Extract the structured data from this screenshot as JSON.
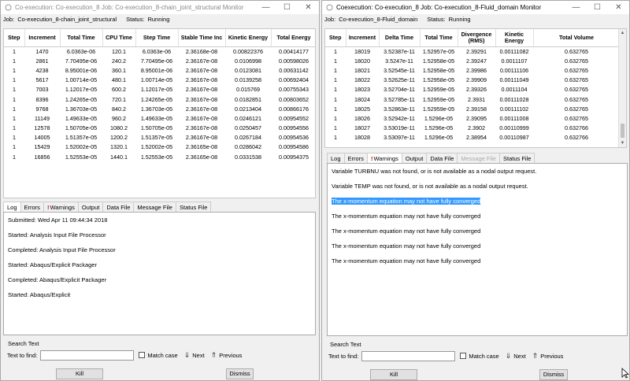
{
  "windows": [
    {
      "title": "Co-execution: Co-execution_8 Job: Co-execution_8-chain_joint_structural Monitor",
      "job_label": "Job:",
      "job": "Co-execution_8-chain_joint_structural",
      "status_label": "Status:",
      "status": "Running",
      "columns": [
        "Step",
        "Increment",
        "Total Time",
        "CPU Time",
        "Step Time",
        "Stable Time Inc",
        "Kinetic Energy",
        "Total Energy"
      ],
      "rows": [
        [
          "1",
          "1470",
          "6.0363e-06",
          "120.1",
          "6.0363e-06",
          "2.36168e-08",
          "0.00822376",
          "0.00414177"
        ],
        [
          "1",
          "2861",
          "7.70495e-06",
          "240.2",
          "7.70495e-06",
          "2.36167e-08",
          "0.0106998",
          "0.00598026"
        ],
        [
          "1",
          "4238",
          "8.95001e-06",
          "360.1",
          "8.95001e-06",
          "2.36167e-08",
          "0.0123081",
          "0.00631142"
        ],
        [
          "1",
          "5617",
          "1.00714e-05",
          "480.1",
          "1.00714e-05",
          "2.36167e-08",
          "0.0139258",
          "0.00692404"
        ],
        [
          "1",
          "7003",
          "1.12017e-05",
          "600.2",
          "1.12017e-05",
          "2.36167e-08",
          "0.015769",
          "0.00755343"
        ],
        [
          "1",
          "8396",
          "1.24265e-05",
          "720.1",
          "1.24265e-05",
          "2.36167e-08",
          "0.0182851",
          "0.00803652"
        ],
        [
          "1",
          "9768",
          "1.36703e-05",
          "840.2",
          "1.36703e-05",
          "2.36167e-08",
          "0.0213404",
          "0.00866176"
        ],
        [
          "1",
          "11149",
          "1.49633e-05",
          "960.2",
          "1.49633e-05",
          "2.36167e-08",
          "0.0246121",
          "0.00954552"
        ],
        [
          "1",
          "12578",
          "1.50705e-05",
          "1080.2",
          "1.50705e-05",
          "2.36167e-08",
          "0.0250457",
          "0.00954556"
        ],
        [
          "1",
          "14005",
          "1.51357e-05",
          "1200.2",
          "1.51357e-05",
          "2.36167e-08",
          "0.0267184",
          "0.00954536"
        ],
        [
          "1",
          "15429",
          "1.52002e-05",
          "1320.1",
          "1.52002e-05",
          "2.36165e-08",
          "0.0286042",
          "0.00954586"
        ],
        [
          "1",
          "16856",
          "1.52553e-05",
          "1440.1",
          "1.52553e-05",
          "2.36165e-08",
          "0.0331538",
          "0.00954375"
        ]
      ],
      "tabs": [
        {
          "label": "Log",
          "active": true,
          "warn": false,
          "disabled": false
        },
        {
          "label": "Errors",
          "active": false,
          "warn": false,
          "disabled": false
        },
        {
          "label": "Warnings",
          "active": false,
          "warn": true,
          "disabled": false
        },
        {
          "label": "Output",
          "active": false,
          "warn": false,
          "disabled": false
        },
        {
          "label": "Data File",
          "active": false,
          "warn": false,
          "disabled": false
        },
        {
          "label": "Message File",
          "active": false,
          "warn": false,
          "disabled": false
        },
        {
          "label": "Status File",
          "active": false,
          "warn": false,
          "disabled": false
        }
      ],
      "log_lines": [
        "Submitted: Wed Apr 11 09:44:34 2018",
        "Started:   Analysis Input File Processor",
        "Completed: Analysis Input File Processor",
        "Started:   Abaqus/Explicit Packager",
        "Completed: Abaqus/Explicit Packager",
        "Started:   Abaqus/Explicit"
      ],
      "selected_line": -1,
      "search_title": "Search Text",
      "find_label": "Text to find:",
      "match_case": "Match case",
      "next": "Next",
      "previous": "Previous",
      "kill": "Kill",
      "dismiss": "Dismiss"
    },
    {
      "title": "Coexecution: Co-execution_8 Job: Co-execution_8-Fluid_domain Monitor",
      "job_label": "Job:",
      "job": "Co-execution_8-Fluid_domain",
      "status_label": "Status:",
      "status": "Running",
      "columns": [
        "Step",
        "Increment",
        "Delta Time",
        "Total Time",
        "Divergence (RMS)",
        "Kinetic Energy",
        "Total Volume"
      ],
      "rows": [
        [
          "1",
          "18019",
          "3.52387e-11",
          "1.52957e-05",
          "2.39291",
          "0.00111082",
          "0.632765"
        ],
        [
          "1",
          "18020",
          "3.5247e-11",
          "1.52958e-05",
          "2.39247",
          "0.0011107",
          "0.632765"
        ],
        [
          "1",
          "18021",
          "3.52545e-11",
          "1.52958e-05",
          "2.39986",
          "0.00111106",
          "0.632765"
        ],
        [
          "1",
          "18022",
          "3.52625e-11",
          "1.52958e-05",
          "2.39909",
          "0.00111049",
          "0.632765"
        ],
        [
          "1",
          "18023",
          "3.52704e-11",
          "1.52959e-05",
          "2.39326",
          "0.0011104",
          "0.632765"
        ],
        [
          "1",
          "18024",
          "3.52785e-11",
          "1.52959e-05",
          "2.3931",
          "0.00111028",
          "0.632765"
        ],
        [
          "1",
          "18025",
          "3.52863e-11",
          "1.52959e-05",
          "2.39158",
          "0.00111102",
          "0.632765"
        ],
        [
          "1",
          "18026",
          "3.52942e-11",
          "1.5296e-05",
          "2.39095",
          "0.00111008",
          "0.632765"
        ],
        [
          "1",
          "18027",
          "3.53019e-11",
          "1.5296e-05",
          "2.3902",
          "0.00110999",
          "0.632766"
        ],
        [
          "1",
          "18028",
          "3.53097e-11",
          "1.5296e-05",
          "2.38954",
          "0.00110987",
          "0.632766"
        ]
      ],
      "tabs": [
        {
          "label": "Log",
          "active": false,
          "warn": false,
          "disabled": false
        },
        {
          "label": "Errors",
          "active": false,
          "warn": false,
          "disabled": false
        },
        {
          "label": "Warnings",
          "active": true,
          "warn": true,
          "disabled": false
        },
        {
          "label": "Output",
          "active": false,
          "warn": false,
          "disabled": false
        },
        {
          "label": "Data File",
          "active": false,
          "warn": false,
          "disabled": false
        },
        {
          "label": "Message File",
          "active": false,
          "warn": false,
          "disabled": true
        },
        {
          "label": "Status File",
          "active": false,
          "warn": false,
          "disabled": false
        }
      ],
      "log_lines": [
        "Variable TURBNU was not found, or is not available as a nodal output request.",
        "Variable TEMP was not found, or is not available as a nodal output request.",
        "The x-momentum equation may not have fully converged",
        "The x-momentum equation may not have fully converged",
        "The x-momentum equation may not have fully converged",
        "The x-momentum equation may not have fully converged",
        "The x-momentum equation may not have fully converged"
      ],
      "selected_line": 2,
      "search_title": "Search Text",
      "find_label": "Text to find:",
      "match_case": "Match case",
      "next": "Next",
      "previous": "Previous",
      "kill": "Kill",
      "dismiss": "Dismiss"
    }
  ],
  "icons": {
    "minimize": "minimize-icon",
    "maximize": "maximize-icon",
    "close": "close-icon",
    "next": "arrow-down-icon",
    "previous": "arrow-up-icon",
    "warning": "warning-icon"
  }
}
